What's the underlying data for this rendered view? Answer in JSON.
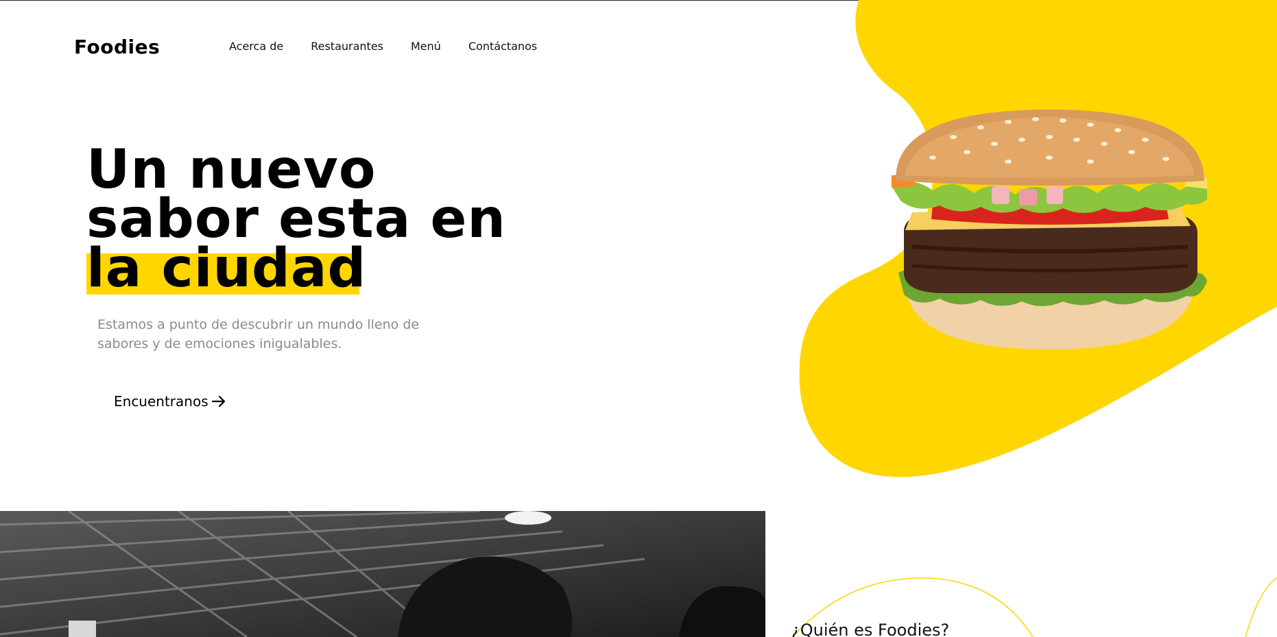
{
  "brand": {
    "logo": "Foodies",
    "accent_color": "#ffd600"
  },
  "nav": {
    "items": [
      {
        "label": "Acerca de"
      },
      {
        "label": "Restaurantes"
      },
      {
        "label": "Menú"
      },
      {
        "label": "Contáctanos"
      }
    ]
  },
  "hero": {
    "title_line1": "Un nuevo",
    "title_line2": "sabor esta en",
    "title_line3": "la ciudad",
    "subtitle": "Estamos a punto de descubrir un mundo lleno de sabores y de emociones inigualables.",
    "cta_label": "Encuentranos",
    "cta_icon": "arrow-right-icon",
    "image": "burger-image"
  },
  "about": {
    "title": "¿Quién es Foodies?",
    "image": "restaurant-photo"
  }
}
